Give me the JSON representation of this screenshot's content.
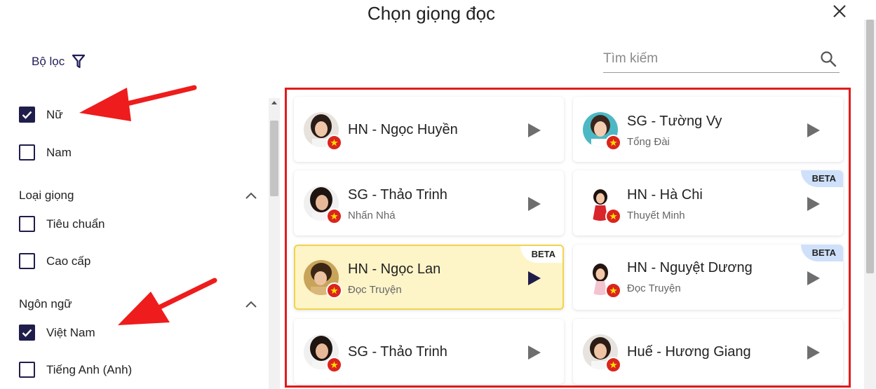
{
  "dialog": {
    "title": "Chọn giọng đọc"
  },
  "filter": {
    "label": "Bộ lọc"
  },
  "search": {
    "placeholder": "Tìm kiếm"
  },
  "gender": [
    {
      "label": "Nữ",
      "checked": true
    },
    {
      "label": "Nam",
      "checked": false
    }
  ],
  "voice_type": {
    "heading": "Loại giọng",
    "options": [
      {
        "label": "Tiêu chuẩn",
        "checked": false
      },
      {
        "label": "Cao cấp",
        "checked": false
      }
    ]
  },
  "language": {
    "heading": "Ngôn ngữ",
    "options": [
      {
        "label": "Việt Nam",
        "checked": true
      },
      {
        "label": "Tiếng Anh (Anh)",
        "checked": false
      }
    ]
  },
  "voices": [
    {
      "name": "HN - Ngọc Huyền",
      "style": "",
      "beta": false,
      "active": false
    },
    {
      "name": "SG - Tường Vy",
      "style": "Tổng Đài",
      "beta": false,
      "active": false
    },
    {
      "name": "SG - Thảo Trinh",
      "style": "Nhấn Nhá",
      "beta": false,
      "active": false
    },
    {
      "name": "HN - Hà Chi",
      "style": "Thuyết Minh",
      "beta": true,
      "active": false
    },
    {
      "name": "HN - Ngọc Lan",
      "style": "Đọc Truyện",
      "beta": true,
      "active": true
    },
    {
      "name": "HN - Nguyệt Dương",
      "style": "Đọc Truyện",
      "beta": true,
      "active": false
    },
    {
      "name": "SG - Thảo Trinh",
      "style": "",
      "beta": false,
      "active": false
    },
    {
      "name": "Huế - Hương Giang",
      "style": "",
      "beta": false,
      "active": false
    }
  ],
  "beta_label": "BETA",
  "colors": {
    "accent": "#1f1d4a",
    "highlight_border": "#e21b1b",
    "active_card": "#fdf4c8",
    "flag_red": "#da251d"
  }
}
